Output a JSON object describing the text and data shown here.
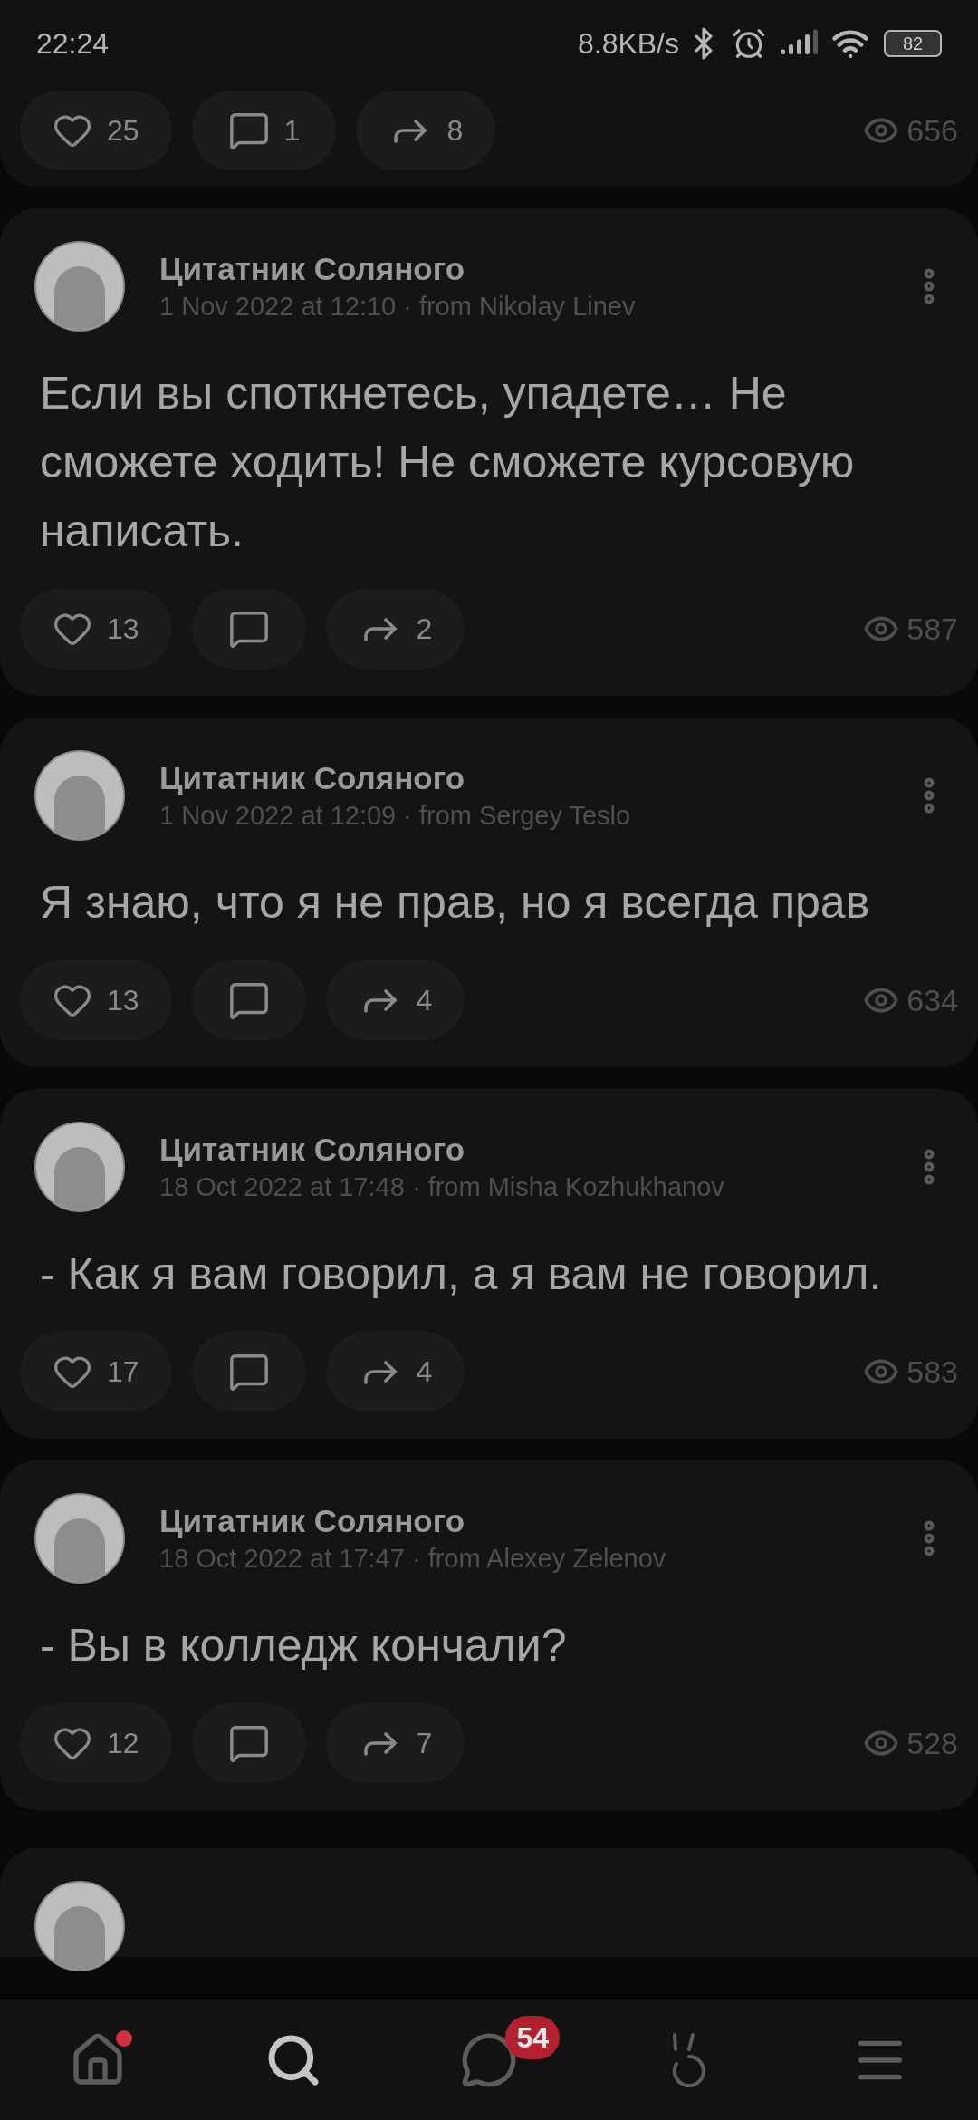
{
  "status_bar": {
    "time": "22:24",
    "net_speed": "8.8KB/s",
    "battery": "82"
  },
  "top_post": {
    "likes": "25",
    "comments": "1",
    "shares": "8",
    "views": "656"
  },
  "posts": [
    {
      "author": "Цитатник Соляного",
      "meta": "1 Nov 2022 at 12:10 · from Nikolay Linev",
      "text": "Если вы споткнетесь, упадете… Не сможете ходить! Не сможете курсовую написать.",
      "likes": "13",
      "shares": "2",
      "views": "587"
    },
    {
      "author": "Цитатник Соляного",
      "meta": "1 Nov 2022 at 12:09 · from Sergey Teslo",
      "text": "Я знаю, что я не прав, но я всегда прав",
      "likes": "13",
      "shares": "4",
      "views": "634"
    },
    {
      "author": "Цитатник Соляного",
      "meta": "18 Oct 2022 at 17:48 · from Misha Kozhukhanov",
      "text": "- Как я вам говорил, а я вам не говорил.",
      "likes": "17",
      "shares": "4",
      "views": "583"
    },
    {
      "author": "Цитатник Соляного",
      "meta": "18 Oct 2022 at 17:47 · from Alexey Zelenov",
      "text": "- Вы в колледж кончали?",
      "likes": "12",
      "shares": "7",
      "views": "528"
    }
  ],
  "nav": [
    {
      "kind": "home",
      "selected": false,
      "dot": true
    },
    {
      "kind": "search",
      "selected": true,
      "dot": false
    },
    {
      "kind": "messages",
      "selected": false,
      "dot": false,
      "badge": "54"
    },
    {
      "kind": "services",
      "selected": false,
      "dot": false
    },
    {
      "kind": "menu",
      "selected": false,
      "dot": false
    }
  ]
}
